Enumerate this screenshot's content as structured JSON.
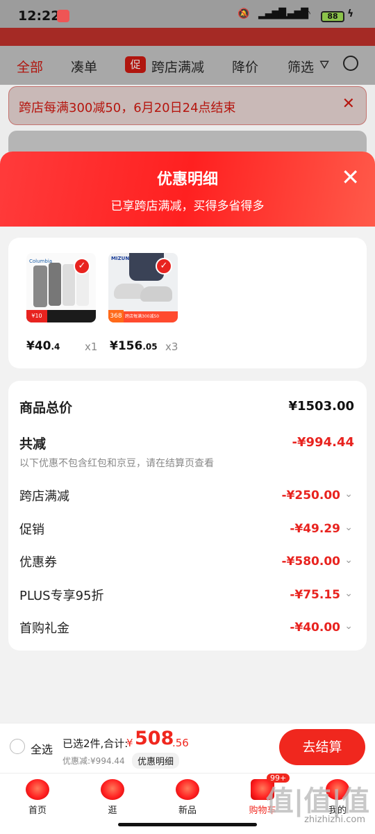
{
  "status": {
    "time": "12:22",
    "battery": "88"
  },
  "tabs": [
    {
      "label": "全部"
    },
    {
      "label": "凑单"
    },
    {
      "badge": "促",
      "label": "跨店满减"
    },
    {
      "label": "降价"
    },
    {
      "label": "筛选"
    }
  ],
  "promo": {
    "text": "跨店每满300减50，6月20日24点结束"
  },
  "sheet": {
    "title": "优惠明细",
    "subtitle": "已享跨店满减，买得多省得多",
    "products": [
      {
        "brand": "Columbia",
        "price_int": "¥40",
        "price_dec": ".4",
        "qty": "x1",
        "tag": "¥10"
      },
      {
        "brand": "MIZUNO",
        "price_int": "¥156",
        "price_dec": ".05",
        "qty": "x3",
        "tag": "368",
        "promo": "跨店每满300减50"
      }
    ],
    "summary": {
      "total_label": "商品总价",
      "total_value": "¥1503.00",
      "discount_label": "共减",
      "discount_value": "-¥994.44",
      "note": "以下优惠不包含红包和京豆，请在结算页查看",
      "items": [
        {
          "label": "跨店满减",
          "value": "-¥250.00"
        },
        {
          "label": "促销",
          "value": "-¥49.29"
        },
        {
          "label": "优惠券",
          "value": "-¥580.00"
        },
        {
          "label": "PLUS专享95折",
          "value": "-¥75.15"
        },
        {
          "label": "首购礼金",
          "value": "-¥40.00"
        }
      ]
    }
  },
  "bottom": {
    "select_all": "全选",
    "selected": "已选2件,合计:",
    "currency": "¥",
    "total_int": "508",
    "total_dec": ".56",
    "saved": "优惠减:¥994.44",
    "detail_btn": "优惠明细",
    "checkout": "去结算"
  },
  "tabbar": [
    {
      "label": "首页"
    },
    {
      "label": "逛"
    },
    {
      "label": "新品"
    },
    {
      "label": "购物车",
      "badge": "99+"
    },
    {
      "label": "我的"
    }
  ],
  "watermark": {
    "big": "值|值|值",
    "small": "zhizhizhi.com"
  },
  "colors": {
    "accent": "#f0271e",
    "dim_overlay": "#9c9c9c"
  }
}
